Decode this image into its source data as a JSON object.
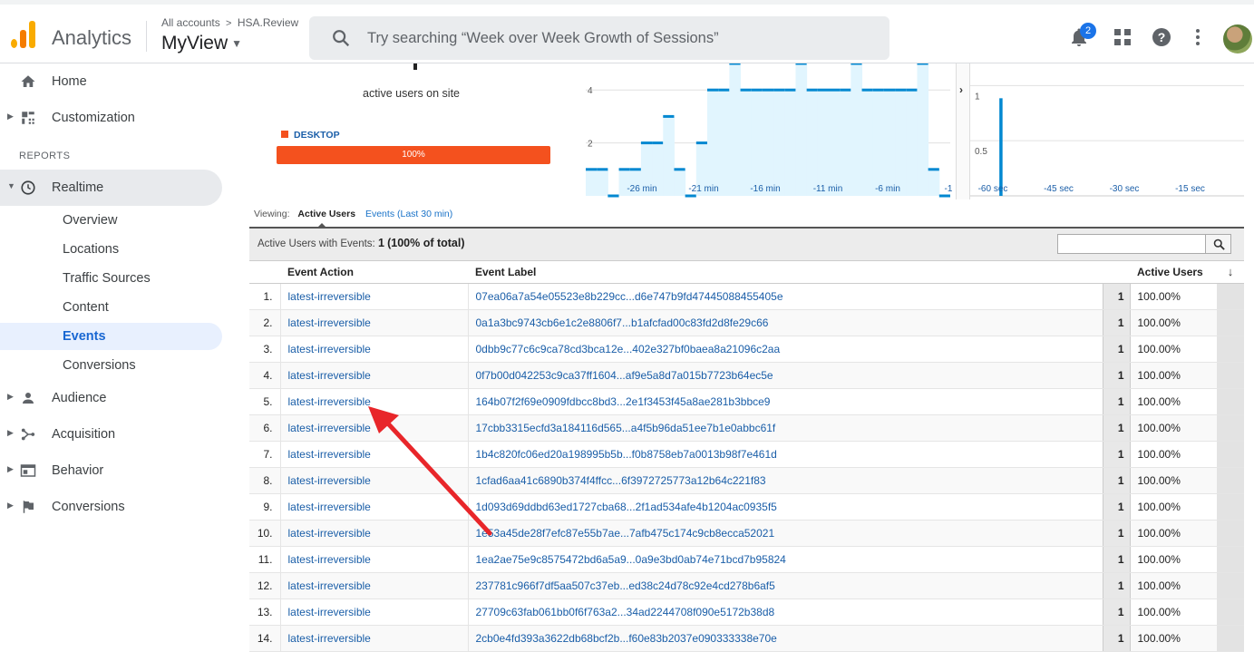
{
  "app": {
    "name": "Analytics"
  },
  "header": {
    "crumb_all": "All accounts",
    "crumb_sep": ">",
    "crumb_account": "HSA.Review",
    "view": "MyView",
    "search_placeholder": "Try searching “Week over Week Growth of Sessions”",
    "notifications_count": "2"
  },
  "sidebar": {
    "home": "Home",
    "customization": "Customization",
    "reports_label": "REPORTS",
    "realtime": "Realtime",
    "realtime_sub": [
      "Overview",
      "Locations",
      "Traffic Sources",
      "Content",
      "Events",
      "Conversions"
    ],
    "audience": "Audience",
    "acquisition": "Acquisition",
    "behavior": "Behavior",
    "conversions": "Conversions"
  },
  "summary": {
    "active_users_text": "active users on site",
    "device_label": "DESKTOP",
    "device_pct": "100%",
    "device_fraction": 1.0
  },
  "chart_data": [
    {
      "type": "bar",
      "title": "",
      "x_ticks": [
        "-26 min",
        "-21 min",
        "-16 min",
        "-11 min",
        "-6 min",
        "-1"
      ],
      "y_ticks": [
        "4",
        "2"
      ],
      "values": [
        1,
        1,
        0,
        1,
        1,
        2,
        2,
        3,
        1,
        0,
        2,
        4,
        4,
        5,
        4,
        4,
        4,
        4,
        4,
        5,
        4,
        4,
        4,
        4,
        5,
        4,
        4,
        4,
        4,
        4,
        5,
        1,
        0
      ],
      "ylim": [
        0,
        5
      ]
    },
    {
      "type": "bar",
      "title": "",
      "x_ticks": [
        "-60 sec",
        "-45 sec",
        "-30 sec",
        "-15 sec"
      ],
      "y_ticks": [
        "1",
        "0.5"
      ],
      "x": [
        -55
      ],
      "values": [
        1
      ],
      "ylim": [
        0,
        1.2
      ]
    }
  ],
  "viewing": {
    "label": "Viewing:",
    "active_tab": "Active Users",
    "other_tab": "Events (Last 30 min)"
  },
  "table": {
    "summary_label": "Active Users with Events:",
    "summary_value": "1",
    "summary_pct": "(100% of total)",
    "headers": {
      "action": "Event Action",
      "label": "Event Label",
      "users": "Active Users"
    },
    "rows": [
      {
        "n": "1.",
        "action": "latest-irreversible",
        "label": "07ea06a7a54e05523e8b229cc...d6e747b9fd47445088455405e",
        "count": "1",
        "pct": "100.00%"
      },
      {
        "n": "2.",
        "action": "latest-irreversible",
        "label": "0a1a3bc9743cb6e1c2e8806f7...b1afcfad00c83fd2d8fe29c66",
        "count": "1",
        "pct": "100.00%"
      },
      {
        "n": "3.",
        "action": "latest-irreversible",
        "label": "0dbb9c77c6c9ca78cd3bca12e...402e327bf0baea8a21096c2aa",
        "count": "1",
        "pct": "100.00%"
      },
      {
        "n": "4.",
        "action": "latest-irreversible",
        "label": "0f7b00d042253c9ca37ff1604...af9e5a8d7a015b7723b64ec5e",
        "count": "1",
        "pct": "100.00%"
      },
      {
        "n": "5.",
        "action": "latest-irreversible",
        "label": "164b07f2f69e0909fdbcc8bd3...2e1f3453f45a8ae281b3bbce9",
        "count": "1",
        "pct": "100.00%"
      },
      {
        "n": "6.",
        "action": "latest-irreversible",
        "label": "17cbb3315ecfd3a184116d565...a4f5b96da51ee7b1e0abbc61f",
        "count": "1",
        "pct": "100.00%"
      },
      {
        "n": "7.",
        "action": "latest-irreversible",
        "label": "1b4c820fc06ed20a198995b5b...f0b8758eb7a0013b98f7e461d",
        "count": "1",
        "pct": "100.00%"
      },
      {
        "n": "8.",
        "action": "latest-irreversible",
        "label": "1cfad6aa41c6890b374f4ffcc...6f3972725773a12b64c221f83",
        "count": "1",
        "pct": "100.00%"
      },
      {
        "n": "9.",
        "action": "latest-irreversible",
        "label": "1d093d69ddbd63ed1727cba68...2f1ad534afe4b1204ac0935f5",
        "count": "1",
        "pct": "100.00%"
      },
      {
        "n": "10.",
        "action": "latest-irreversible",
        "label": "1e53a45de28f7efc87e55b7ae...7afb475c174c9cb8ecca52021",
        "count": "1",
        "pct": "100.00%"
      },
      {
        "n": "11.",
        "action": "latest-irreversible",
        "label": "1ea2ae75e9c8575472bd6a5a9...0a9e3bd0ab74e71bcd7b95824",
        "count": "1",
        "pct": "100.00%"
      },
      {
        "n": "12.",
        "action": "latest-irreversible",
        "label": "237781c966f7df5aa507c37eb...ed38c24d78c92e4cd278b6af5",
        "count": "1",
        "pct": "100.00%"
      },
      {
        "n": "13.",
        "action": "latest-irreversible",
        "label": "27709c63fab061bb0f6f763a2...34ad2244708f090e5172b38d8",
        "count": "1",
        "pct": "100.00%"
      },
      {
        "n": "14.",
        "action": "latest-irreversible",
        "label": "2cb0e4fd393a3622db68bcf2b...f60e83b2037e090333338e70e",
        "count": "1",
        "pct": "100.00%"
      }
    ]
  },
  "colors": {
    "accent": "#1967d2",
    "device_bar": "#f4511e",
    "chart_line": "#0288d1",
    "chart_fill": "#e1f5fe",
    "annotation_arrow": "#e8262a"
  },
  "icons": [
    "search-icon",
    "bell-icon",
    "apps-grid-icon",
    "help-icon",
    "more-vert-icon",
    "home-icon",
    "customization-icon",
    "clock-icon",
    "person-icon",
    "acquisition-icon",
    "behavior-icon",
    "flag-icon"
  ]
}
